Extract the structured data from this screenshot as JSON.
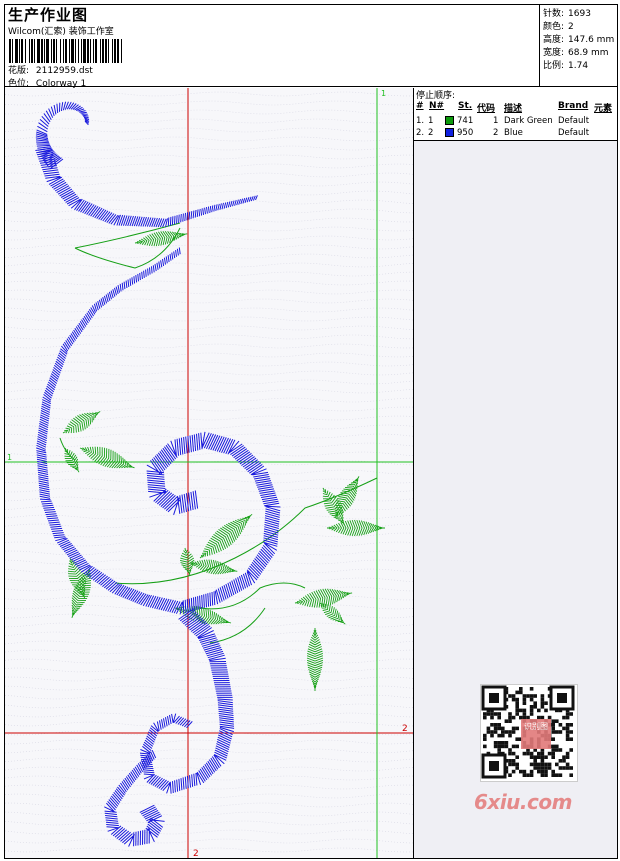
{
  "header": {
    "title": "生产作业图",
    "studio": "Wilcom(汇索) 装饰工作室",
    "design_label": "花版:",
    "design_file": "2112959.dst",
    "colorway_label": "色位:",
    "colorway": "Colorway 1"
  },
  "stats": [
    {
      "label": "针数:",
      "value": "1693"
    },
    {
      "label": "颜色:",
      "value": "2"
    },
    {
      "label": "高度:",
      "value": "147.6 mm"
    },
    {
      "label": "宽度:",
      "value": "68.9 mm"
    },
    {
      "label": "比例:",
      "value": "1.74"
    }
  ],
  "stop_sequence": {
    "label": "停止顺序:",
    "headers": [
      "#",
      "N#",
      "St.",
      "代码",
      "描述",
      "Brand",
      "元素"
    ],
    "rows": [
      {
        "index": "1.",
        "n": "1",
        "swatch": "#0c9a0c",
        "st": "741",
        "code": "1",
        "desc": "Dark Green",
        "brand": "Default"
      },
      {
        "index": "2.",
        "n": "2",
        "swatch": "#1020e0",
        "st": "950",
        "code": "2",
        "desc": "Blue",
        "brand": "Default"
      }
    ]
  },
  "guides": {
    "green_v": "1",
    "green_h": "1",
    "red_h": "2",
    "red_v": "2"
  },
  "colors": {
    "thread_blue": "#1a1adc",
    "thread_green": "#16a016",
    "guide_red": "#cc0000",
    "guide_green": "#22c022"
  },
  "watermark": {
    "text": "6xiu.com",
    "seal": "识别图"
  }
}
